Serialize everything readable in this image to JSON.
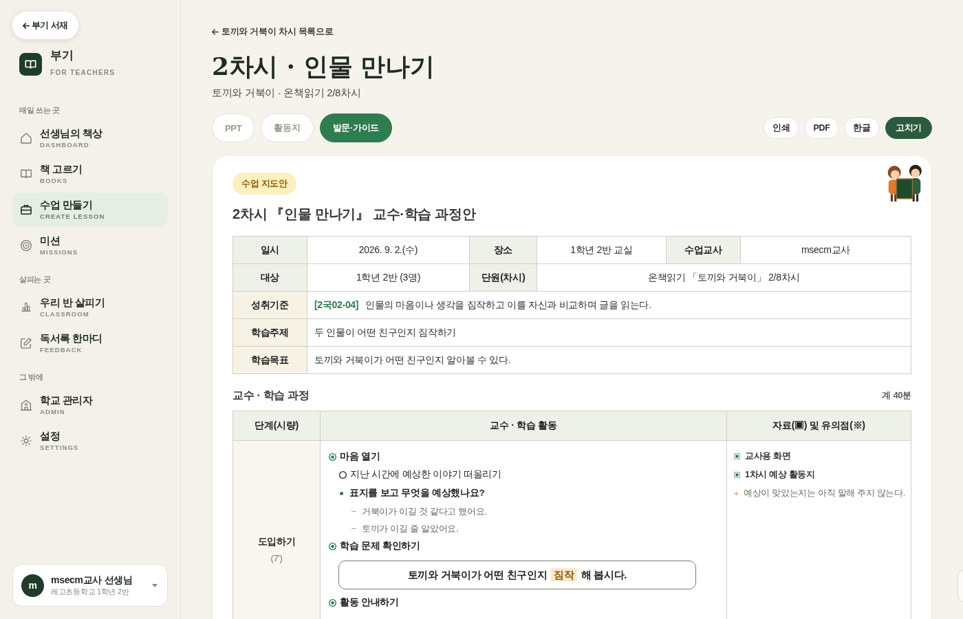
{
  "sidebar": {
    "back_button": {
      "label": "부기 서재"
    },
    "brand": {
      "name": "부기",
      "tagline": "FOR TEACHERS"
    },
    "sections": [
      {
        "title": "매일 쓰는 곳",
        "items": [
          {
            "label": "선생님의 책상",
            "sublabel": "DASHBOARD",
            "selected": false
          },
          {
            "label": "책 고르기",
            "sublabel": "BOOKS",
            "selected": false
          },
          {
            "label": "수업 만들기",
            "sublabel": "CREATE LESSON",
            "selected": true
          },
          {
            "label": "미션",
            "sublabel": "MISSIONS",
            "selected": false
          }
        ]
      },
      {
        "title": "살피는 곳",
        "items": [
          {
            "label": "우리 반 살피기",
            "sublabel": "CLASSROOM",
            "selected": false
          },
          {
            "label": "독서록 한마디",
            "sublabel": "FEEDBACK",
            "selected": false
          }
        ]
      },
      {
        "title": "그 밖에",
        "items": [
          {
            "label": "학교 관리자",
            "sublabel": "ADMIN",
            "selected": false
          },
          {
            "label": "설정",
            "sublabel": "SETTINGS",
            "selected": false
          }
        ]
      }
    ],
    "user": {
      "initial": "m",
      "name": "msecm교사 선생님",
      "school": "레고초등학교 1학년 2반"
    }
  },
  "header": {
    "back_link": "토끼와 거북이 차시 목록으로",
    "title": "2차시 · 인물 만나기",
    "subtitle": "토끼와 거북이 · 온책읽기 2/8차시"
  },
  "view_tabs": [
    {
      "label": "PPT",
      "selected": false
    },
    {
      "label": "활동지",
      "selected": false
    },
    {
      "label": "발문·가이드",
      "selected": true
    }
  ],
  "actions": [
    {
      "label": "인쇄",
      "primary": false
    },
    {
      "label": "PDF",
      "primary": false
    },
    {
      "label": "한글",
      "primary": false
    },
    {
      "label": "고치기",
      "primary": true
    }
  ],
  "lesson_plan": {
    "badge": "수업 지도안",
    "title": "2차시 『인물 만나기』 교수·학습 과정안",
    "info_table": [
      [
        {
          "kind": "label",
          "text": "일시"
        },
        {
          "kind": "value",
          "text": "2026. 9. 2.(수)"
        },
        {
          "kind": "label",
          "text": "장소"
        },
        {
          "kind": "value",
          "text": "1학년 2반 교실"
        },
        {
          "kind": "label",
          "text": "수업교사"
        },
        {
          "kind": "value",
          "text": "msecm교사"
        }
      ],
      [
        {
          "kind": "label",
          "text": "대상"
        },
        {
          "kind": "value",
          "text": "1학년 2반 (3명)"
        },
        {
          "kind": "label",
          "text": "단원(차시)"
        },
        {
          "kind": "value",
          "text": "온책읽기 「토끼와 거북이」 2/8차시"
        }
      ],
      [
        {
          "kind": "label",
          "text": "성취기준"
        },
        {
          "kind": "value",
          "text": "**[2국02-04]** 인물의 마음이나 생각을 짐작하고 이를 자신과 비교하며 글을 읽는다."
        }
      ],
      [
        {
          "kind": "label",
          "text": "학습주제"
        },
        {
          "kind": "value",
          "text": "두 인물이 어떤 친구인지 짐작하기"
        }
      ],
      [
        {
          "kind": "label",
          "text": "학습목표"
        },
        {
          "kind": "value",
          "text": "토끼와 거북이가 어떤 친구인지 알아볼 수 있다."
        }
      ]
    ],
    "process": {
      "title": "교수 · 학습 과정",
      "total": "계 40분",
      "columns": [
        "단계(시량)",
        "교수 · 학습 활동",
        "자료(▣) 및 유의점(※)"
      ],
      "stages": [
        {
          "name": "도입하기",
          "time": "(7')",
          "activities": [
            {
              "kind": "heading",
              "text": "마음 열기"
            },
            {
              "kind": "step",
              "text": "지난 시간에 예상한 이야기 떠올리기"
            },
            {
              "kind": "question",
              "text": "표지를 보고 무엇을 예상했나요?"
            },
            {
              "kind": "answer",
              "text": "거북이가 이길 것 같다고 했어요."
            },
            {
              "kind": "answer",
              "text": "토끼가 이길 줄 알았어요."
            },
            {
              "kind": "heading",
              "text": "학습 문제 확인하기"
            },
            {
              "kind": "goal",
              "text": "토끼와 거북이가 어떤 친구인지 **짐작** 해 봅시다."
            },
            {
              "kind": "heading",
              "text": "활동 안내하기"
            }
          ],
          "materials": [
            {
              "kind": "material",
              "text": "교사용 화면"
            },
            {
              "kind": "material",
              "text": "1차시 예상 활동지"
            },
            {
              "kind": "note",
              "text": "예상이 맞았는지는 아직 말해 주지 않는다."
            }
          ]
        }
      ]
    }
  }
}
